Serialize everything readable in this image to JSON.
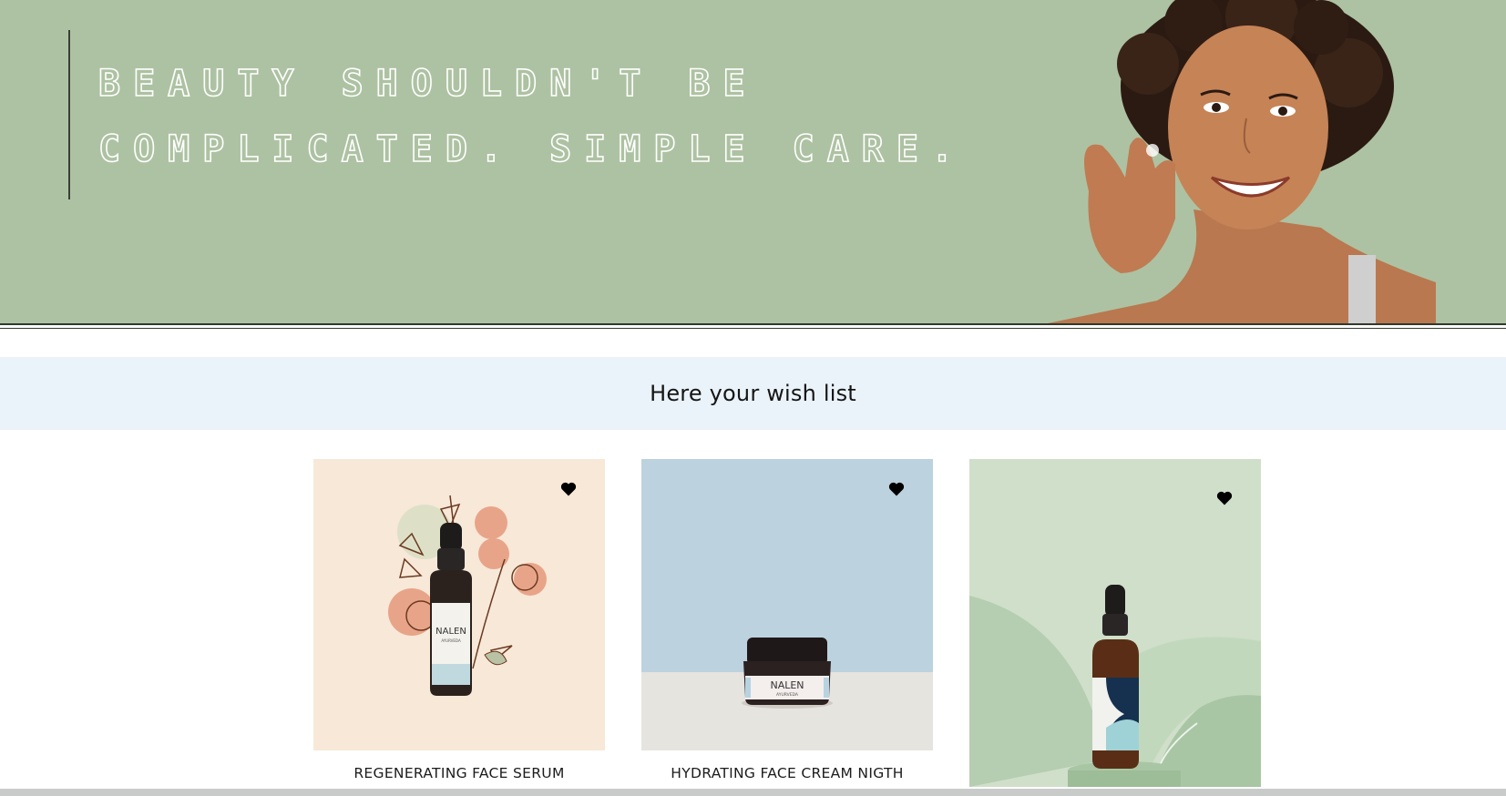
{
  "hero": {
    "headline": "BEAUTY SHOULDN'T BE COMPLICATED. SIMPLE CARE.",
    "background_color": "#adc2a2"
  },
  "wishlist": {
    "title": "Here your wish list",
    "band_color": "#ebf3fa"
  },
  "products": [
    {
      "name": "REGENERATING FACE SERUM",
      "brand": "NALEN",
      "sub_brand": "AYURVEDA",
      "favorite_icon": "heart-icon",
      "image_bg": "#f7e8d8"
    },
    {
      "name": "HYDRATING FACE CREAM NIGTH",
      "brand": "NALEN",
      "sub_brand": "AYURVEDA",
      "favorite_icon": "heart-icon",
      "image_bg": "#bcd2de"
    },
    {
      "name": "",
      "brand": "",
      "favorite_icon": "heart-icon",
      "image_bg": "#cfdfca"
    }
  ]
}
